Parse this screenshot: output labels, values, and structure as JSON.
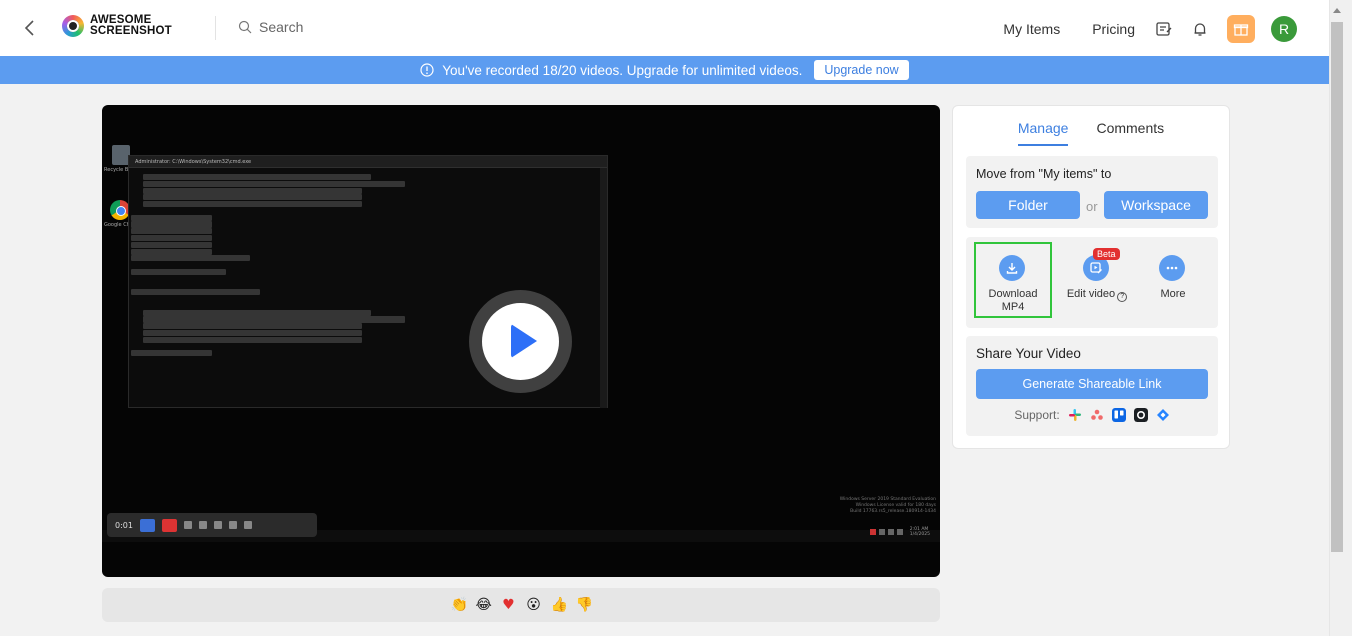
{
  "header": {
    "brand_line1": "AWESOME",
    "brand_line2": "SCREENSHOT",
    "search_placeholder": "Search",
    "nav": {
      "my_items": "My Items",
      "pricing": "Pricing"
    },
    "avatar_initial": "R"
  },
  "banner": {
    "message": "You've recorded 18/20 videos. Upgrade for unlimited videos.",
    "button": "Upgrade now",
    "color": "#5c9cf0"
  },
  "video": {
    "recorder_time": "0:01",
    "desktop_labels": [
      "Recycle Bin",
      "Google Chrome"
    ],
    "terminal_title": "Administrator: C:\\Windows\\System32\\cmd.exe",
    "windows_watermark": "Windows Server 2019 Standard Evaluation\nWindows License valid for 180 days\nBuild 17763.rs5_release.180914-1434",
    "clock": "2:01 AM\n1/4/2025"
  },
  "reactions": [
    "clap",
    "laugh",
    "heart",
    "surprised",
    "thumbs-up",
    "thumbs-down"
  ],
  "panel": {
    "tabs": [
      {
        "label": "Manage",
        "active": true
      },
      {
        "label": "Comments",
        "active": false
      }
    ],
    "move": {
      "title": "Move from \"My items\" to",
      "folder": "Folder",
      "or": "or",
      "workspace": "Workspace"
    },
    "actions": {
      "download_line1": "Download",
      "download_line2": "MP4",
      "edit": "Edit video",
      "edit_badge": "Beta",
      "more": "More"
    },
    "share": {
      "title": "Share Your Video",
      "button": "Generate Shareable Link",
      "support_label": "Support:",
      "integrations": [
        "slack",
        "asana",
        "trello",
        "github",
        "jira"
      ]
    }
  },
  "colors": {
    "accent": "#5c9cf0",
    "highlight": "#31c53b",
    "beta": "#e23030",
    "avatar": "#3a9a3a",
    "gift": "#ffae5e"
  }
}
